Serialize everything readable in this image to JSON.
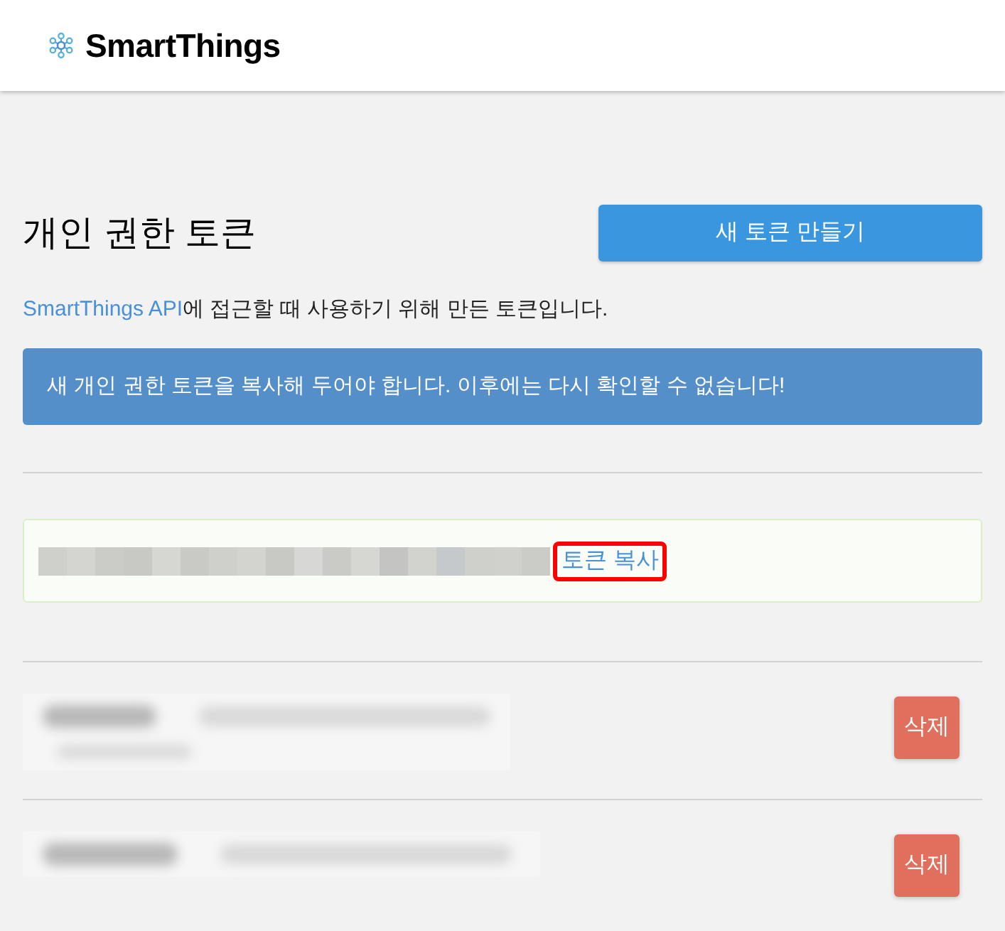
{
  "header": {
    "brand": "SmartThings"
  },
  "page": {
    "title": "개인 권한 토큰",
    "create_button": "새 토큰 만들기",
    "description": {
      "link": "SmartThings API",
      "text": "에 접근할 때 사용하기 위해 만든 토큰입니다."
    },
    "alert": "새 개인 권한 토큰을 복사해 두어야 합니다. 이후에는 다시 확인할 수 없습니다!"
  },
  "new_token": {
    "copy_link": "토큰 복사",
    "highlighted": true
  },
  "tokens": [
    {
      "delete_button": "삭제"
    },
    {
      "delete_button": "삭제"
    }
  ]
}
